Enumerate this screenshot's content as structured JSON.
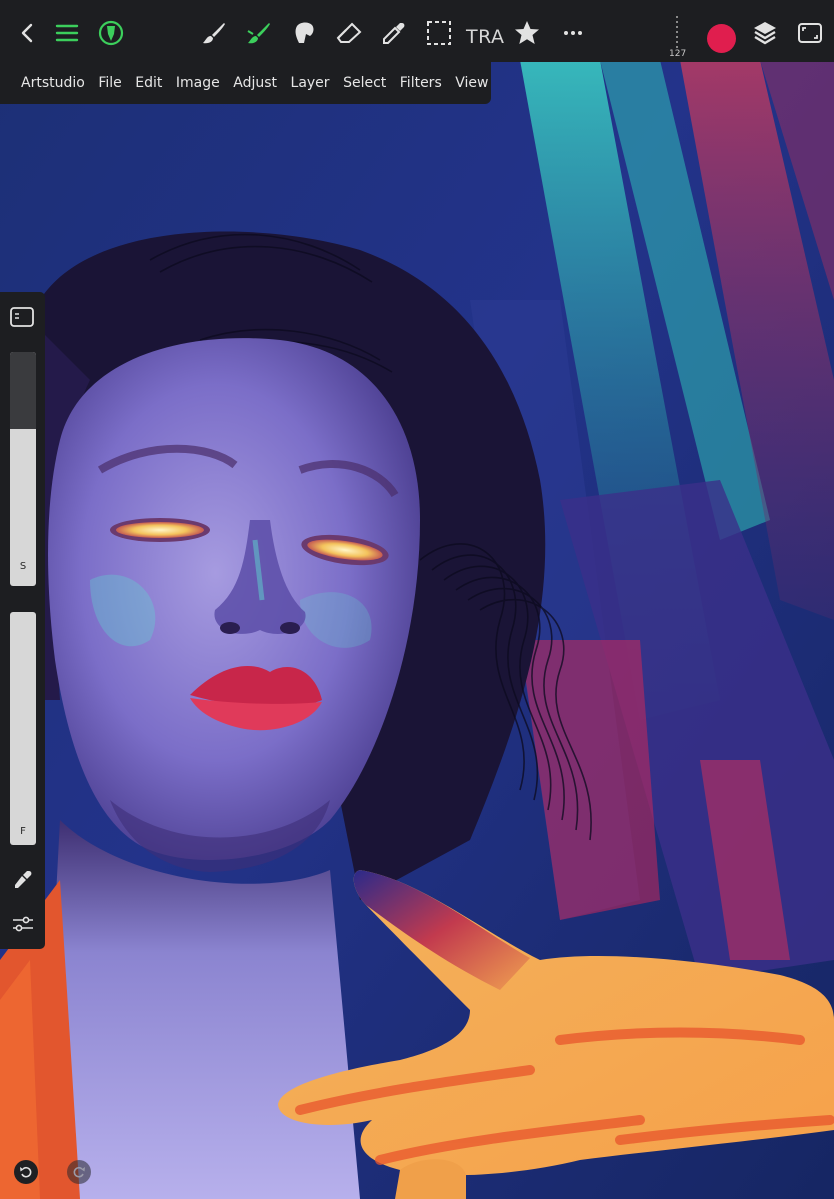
{
  "toolbar": {
    "back": "back-icon",
    "menu": "menu-icon",
    "brush_library": "brush-library-icon",
    "tools": [
      "brush-icon",
      "smudge-icon",
      "blend-icon",
      "eraser-icon",
      "eyedropper-icon",
      "selection-icon"
    ],
    "transform_label": "TRA",
    "favorites": "star-icon",
    "more": "more-icon",
    "brush_size_value": "127",
    "current_color": "#e01e4e",
    "layers": "layers-icon",
    "fullscreen": "fullscreen-icon",
    "accent": "#3ccf5c",
    "icon_color": "#e2e2e2"
  },
  "menubar": {
    "items": [
      "Artstudio",
      "File",
      "Edit",
      "Image",
      "Adjust",
      "Layer",
      "Select",
      "Filters",
      "View"
    ]
  },
  "sidepanel": {
    "panel_toggle": "panel-toggle-icon",
    "size_slider_label": "S",
    "size_slider_level": 0.67,
    "flow_slider_label": "F",
    "flow_slider_level": 1.0,
    "eyedropper": "eyedropper-icon",
    "adjustments": "sliders-icon"
  },
  "history": {
    "undo": "undo-icon",
    "redo": "redo-icon"
  }
}
